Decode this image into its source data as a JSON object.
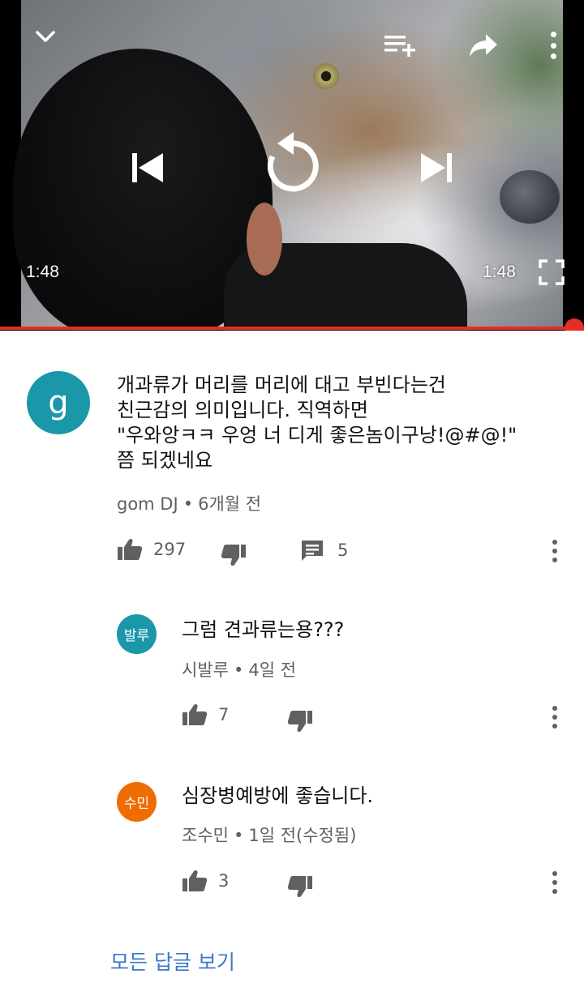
{
  "player": {
    "elapsed_time": "1:48",
    "total_time": "1:48",
    "progress_percent": 100,
    "accent_color": "#e52d27",
    "icons": [
      "chevron-down-icon",
      "add-to-playlist-icon",
      "share-icon",
      "more-vert-icon",
      "skip-previous-icon",
      "replay-icon",
      "skip-next-icon",
      "fullscreen-icon"
    ]
  },
  "comment": {
    "avatar_letter": "g",
    "avatar_color": "#1a97a8",
    "text": "개과류가 머리를 머리에 대고 부빈다는건\n친근감의 의미입니다. 직역하면\n\"우와앙ㅋㅋ 우엉 너 디게 좋은놈이구낭!@#@!\"\n쯤 되겠네요",
    "author": "gom DJ",
    "separator": "•",
    "time": "6개월 전",
    "likes": "297",
    "reply_count": "5"
  },
  "replies": [
    {
      "avatar_label": "발루",
      "avatar_color": "#1a97a8",
      "text": "그럼 견과류는용???",
      "author": "시발루",
      "separator": "•",
      "time": "4일 전",
      "likes": "7"
    },
    {
      "avatar_label": "수민",
      "avatar_color": "#ef6c00",
      "text": "심장병예방에 좋습니다.",
      "author": "조수민",
      "separator": "•",
      "time": "1일 전(수정됨)",
      "likes": "3"
    }
  ],
  "view_all_replies": "모든 답글 보기",
  "colors": {
    "link": "#3a79c9",
    "secondary_text": "#606060"
  }
}
